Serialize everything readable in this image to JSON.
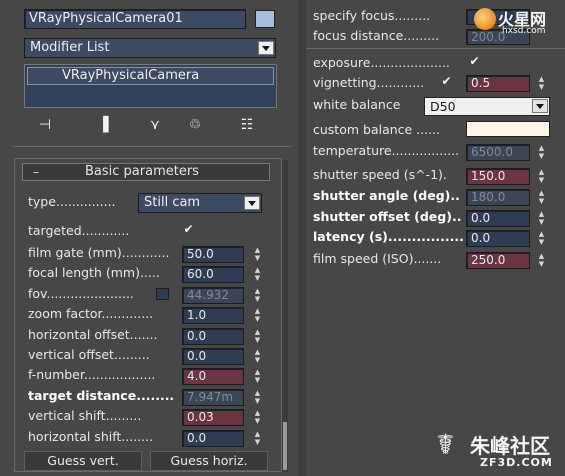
{
  "left": {
    "object_name": "VRayPhysicalCamera01",
    "object_color": "#a9bde0",
    "modifier_list": "Modifier List",
    "stack_item": "VRayPhysicalCamera",
    "toolbar_icons": [
      "pin-stack-icon",
      "show-end-result-icon",
      "make-unique-icon",
      "remove-modifier-icon",
      "configure-modifier-sets-icon"
    ],
    "rollout": {
      "collapse_symbol": "–",
      "title": "Basic parameters",
      "type_label": "type...............",
      "type_value": "Still cam",
      "targeted_label": "targeted............",
      "targeted_check": "✔",
      "rows": [
        {
          "label": "film gate (mm)............",
          "value": "50.0"
        },
        {
          "label": "focal length (mm).....",
          "value": "60.0"
        },
        {
          "label": "fov......................",
          "value": "44.932"
        },
        {
          "label": "zoom factor.............",
          "value": "1.0"
        },
        {
          "label": "horizontal offset.......",
          "value": "0.0"
        },
        {
          "label": "vertical offset.........",
          "value": "0.0"
        },
        {
          "label": "f-number..................",
          "value": "4.0"
        },
        {
          "label": "target distance........",
          "value": "7.947m"
        },
        {
          "label": "vertical shift.........",
          "value": "0.03"
        },
        {
          "label": "horizontal shift........",
          "value": "0.0"
        }
      ],
      "guess_vert": "Guess vert.",
      "guess_horiz": "Guess horiz."
    }
  },
  "right": {
    "specify_focus_label": "specify focus.........",
    "focus_distance_label": "focus distance.........",
    "focus_distance_value": "200.0",
    "exposure_label": "exposure....................",
    "exposure_check": "✔",
    "vignetting_label": "vignetting............",
    "vignetting_check": "✔",
    "vignetting_value": "0.5",
    "white_balance_label": "white balance",
    "white_balance_value": "D50",
    "custom_balance_label": "custom balance ......",
    "custom_balance_color": "#fff4e6",
    "rows": [
      {
        "label": "temperature.................",
        "value": "6500.0"
      },
      {
        "label": "shutter speed (s^-1).",
        "value": "150.0"
      },
      {
        "label": "shutter angle (deg)..",
        "value": "180.0"
      },
      {
        "label": "shutter offset (deg)..",
        "value": "0.0"
      },
      {
        "label": "latency (s)......................",
        "value": "0.0"
      },
      {
        "label": "film speed (ISO).......",
        "value": "250.0"
      }
    ]
  },
  "watermark_top": "火星网",
  "watermark_top_sub": "hxsd.com",
  "watermark_bottom": "朱峰社区",
  "watermark_bottom_sub": "ZF3D.COM"
}
